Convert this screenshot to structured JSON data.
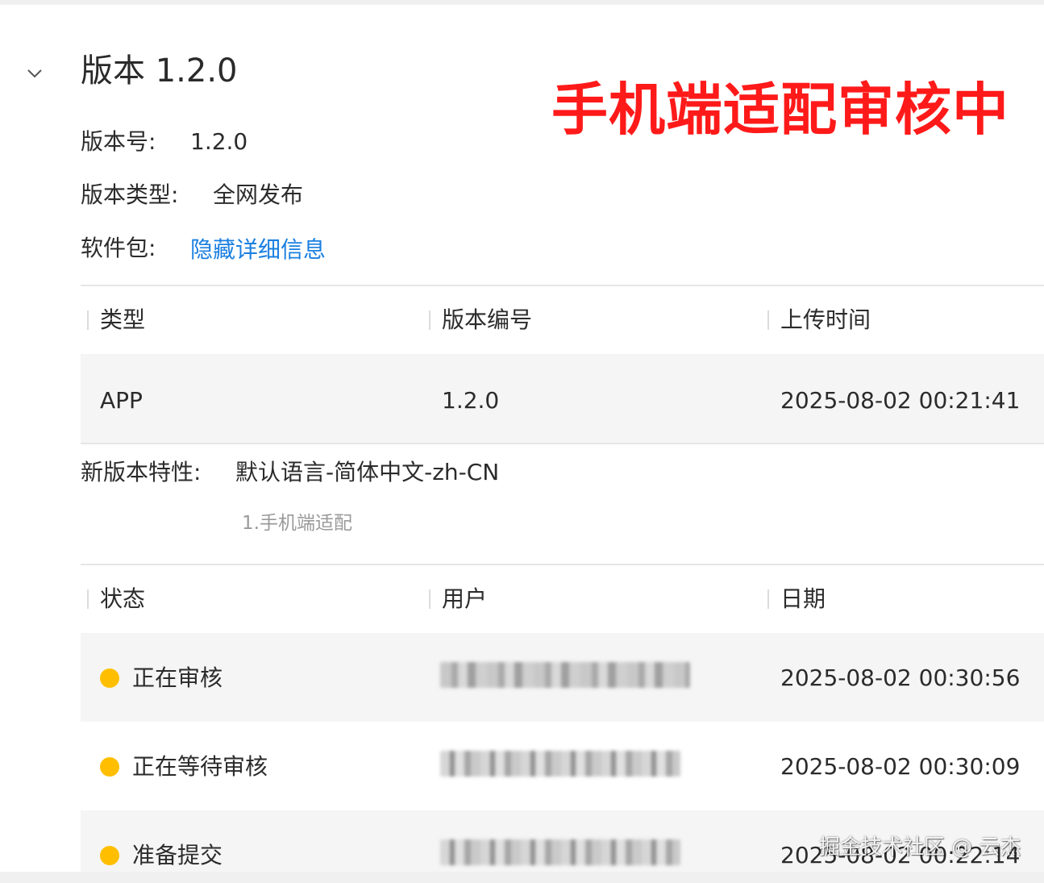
{
  "version_section": {
    "title": "版本 1.2.0",
    "chevron_icon": "chevron-down-icon",
    "version_label": "版本号:",
    "version_value": "1.2.0",
    "type_label": "版本类型:",
    "type_value": "全网发布",
    "package_label": "软件包:",
    "package_link": "隐藏详细信息"
  },
  "overlay_banner": "手机端适配审核中",
  "package_table": {
    "headers": [
      "类型",
      "版本编号",
      "上传时间"
    ],
    "rows": [
      {
        "type": "APP",
        "version": "1.2.0",
        "uploaded": "2025-08-02 00:21:41"
      }
    ]
  },
  "features": {
    "label": "新版本特性:",
    "value": "默认语言-简体中文-zh-CN",
    "note": "1.手机端适配"
  },
  "status_table": {
    "headers": [
      "状态",
      "用户",
      "日期"
    ],
    "rows": [
      {
        "status": "正在审核",
        "status_color": "#ffbf00",
        "user": "",
        "date": "2025-08-02 00:30:56"
      },
      {
        "status": "正在等待审核",
        "status_color": "#ffbf00",
        "user": "",
        "date": "2025-08-02 00:30:09"
      },
      {
        "status": "准备提交",
        "status_color": "#ffbf00",
        "user": "",
        "date": "2025-08-02 00:22:14"
      }
    ]
  },
  "watermark": "掘金技术社区 @ 云杰",
  "colors": {
    "link": "#1a7fe0",
    "banner": "#ff1a1a",
    "status_dot": "#ffbf00",
    "row_shade": "#f5f5f5"
  }
}
